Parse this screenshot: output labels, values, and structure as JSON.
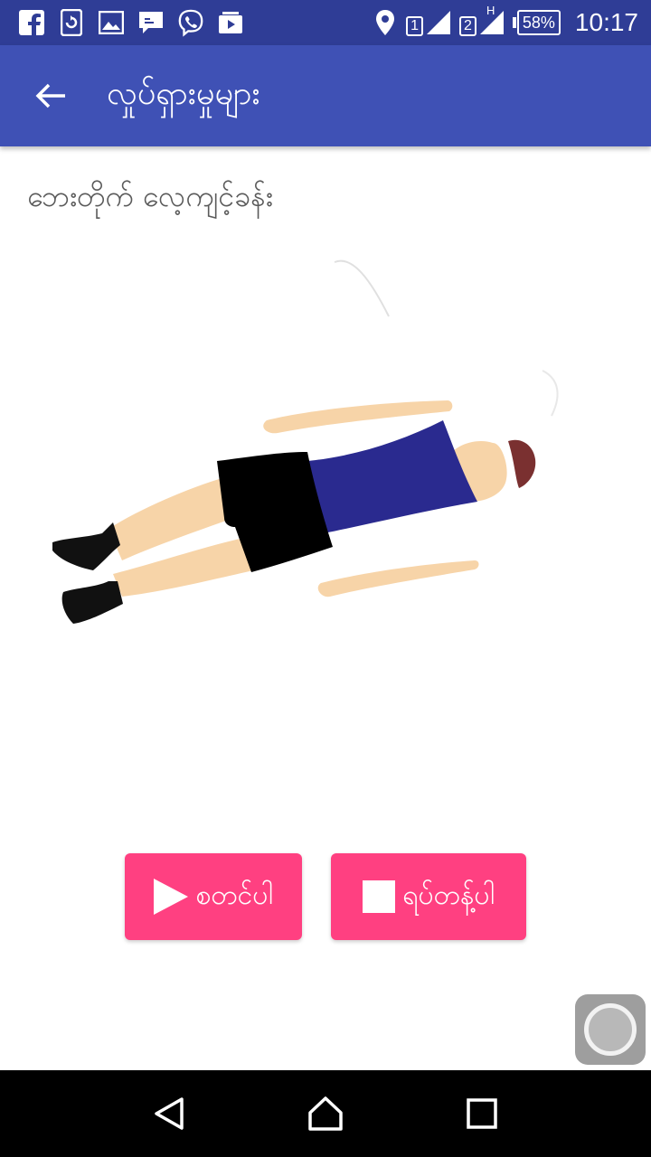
{
  "status_bar": {
    "time": "10:17",
    "battery": "58%",
    "sim1": "1",
    "sim2": "2",
    "network_type": "H",
    "left_icons": [
      "facebook-icon",
      "sync-app-icon",
      "gallery-icon",
      "messenger-icon",
      "viber-icon",
      "media-icon"
    ]
  },
  "app_bar": {
    "title": "လှုပ်ရှားမှုများ",
    "back_icon": "arrow-left-icon"
  },
  "exercise": {
    "name": "ဘေးတိုက် လေ့ကျင့်ခန်း"
  },
  "buttons": {
    "start_label": "စတင်ပါ",
    "stop_label": "ရပ်တန့်ပါ"
  },
  "colors": {
    "status_bar": "#2f3d96",
    "app_bar": "#3f51b5",
    "accent": "#ff4081",
    "shirt": "#2a2a8f",
    "skin": "#f7d4a8"
  },
  "nav": {
    "back": "back-triangle-icon",
    "home": "home-icon",
    "recents": "recents-square-icon"
  }
}
